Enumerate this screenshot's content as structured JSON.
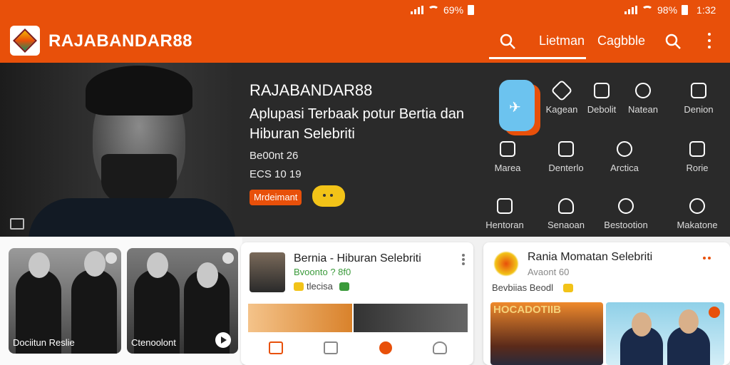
{
  "status_bar": {
    "left_battery": "69%",
    "right_battery": "98%",
    "time": "1:32"
  },
  "app_bar": {
    "brand": "RAJABANDAR88",
    "tabs": [
      {
        "label": "Lietman",
        "active": true
      },
      {
        "label": "Cagbble",
        "active": false
      }
    ],
    "accent_color": "#e8500a"
  },
  "hero": {
    "title": "RAJABANDAR88",
    "subtitle": "Aplupasi Terbaak potur Bertia dan Hiburan Selebriti",
    "meta1": "Be00nt 26",
    "meta2": "ECS 10 19",
    "badge": "Mrdeimant"
  },
  "grid": [
    {
      "label": "Kagean",
      "icon": "diamond-icon"
    },
    {
      "label": "Debolit",
      "icon": "chat-icon"
    },
    {
      "label": "Natean",
      "icon": "sparkle-icon"
    },
    {
      "label": "Denion",
      "icon": "box-icon"
    },
    {
      "label": "Marea",
      "icon": "book-icon"
    },
    {
      "label": "Denterlo",
      "icon": "gift-icon"
    },
    {
      "label": "Arctica",
      "icon": "heart-icon"
    },
    {
      "label": "Rorie",
      "icon": "tablet-icon"
    },
    {
      "label": "Hentoran",
      "icon": "camera-icon"
    },
    {
      "label": "Senaoan",
      "icon": "person-icon"
    },
    {
      "label": "Bestootion",
      "icon": "dollar-icon"
    },
    {
      "label": "Makatone",
      "icon": "clock-icon"
    }
  ],
  "cards": {
    "thumb1_caption": "Dociitun Reslie",
    "thumb2_caption": "Ctenoolont",
    "news1": {
      "title": "Bernia - Hiburan Selebriti",
      "meta": "Bvoonto ? 8f0",
      "tag": "tlecisa"
    },
    "news2": {
      "title": "Rania Momatan Selebriti",
      "meta": "Avaont 60",
      "tag": "Bevbiias Beodl",
      "poster": "HOCADOTIIB"
    }
  }
}
